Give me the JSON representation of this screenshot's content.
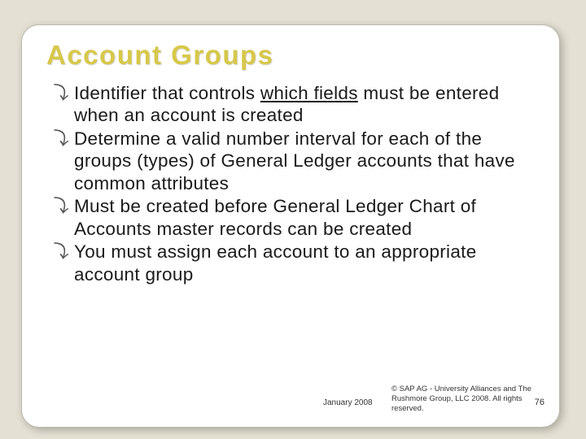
{
  "slide": {
    "title": "Account Groups",
    "bullets": [
      {
        "pre": "Identifier that controls ",
        "underline": "which fields",
        "post": " must be entered when an account is created"
      },
      {
        "pre": "Determine a valid number interval for each of the groups (types) of General Ledger accounts that have common attributes",
        "underline": "",
        "post": ""
      },
      {
        "pre": "Must be created before General Ledger Chart of Accounts master records can be created",
        "underline": "",
        "post": ""
      },
      {
        "pre": "You must assign each account to an appropriate account group",
        "underline": "",
        "post": ""
      }
    ],
    "footer": {
      "date": "January 2008",
      "copyright": "© SAP AG - University Alliances and The Rushmore Group, LLC 2008. All rights reserved.",
      "page": "76"
    }
  }
}
